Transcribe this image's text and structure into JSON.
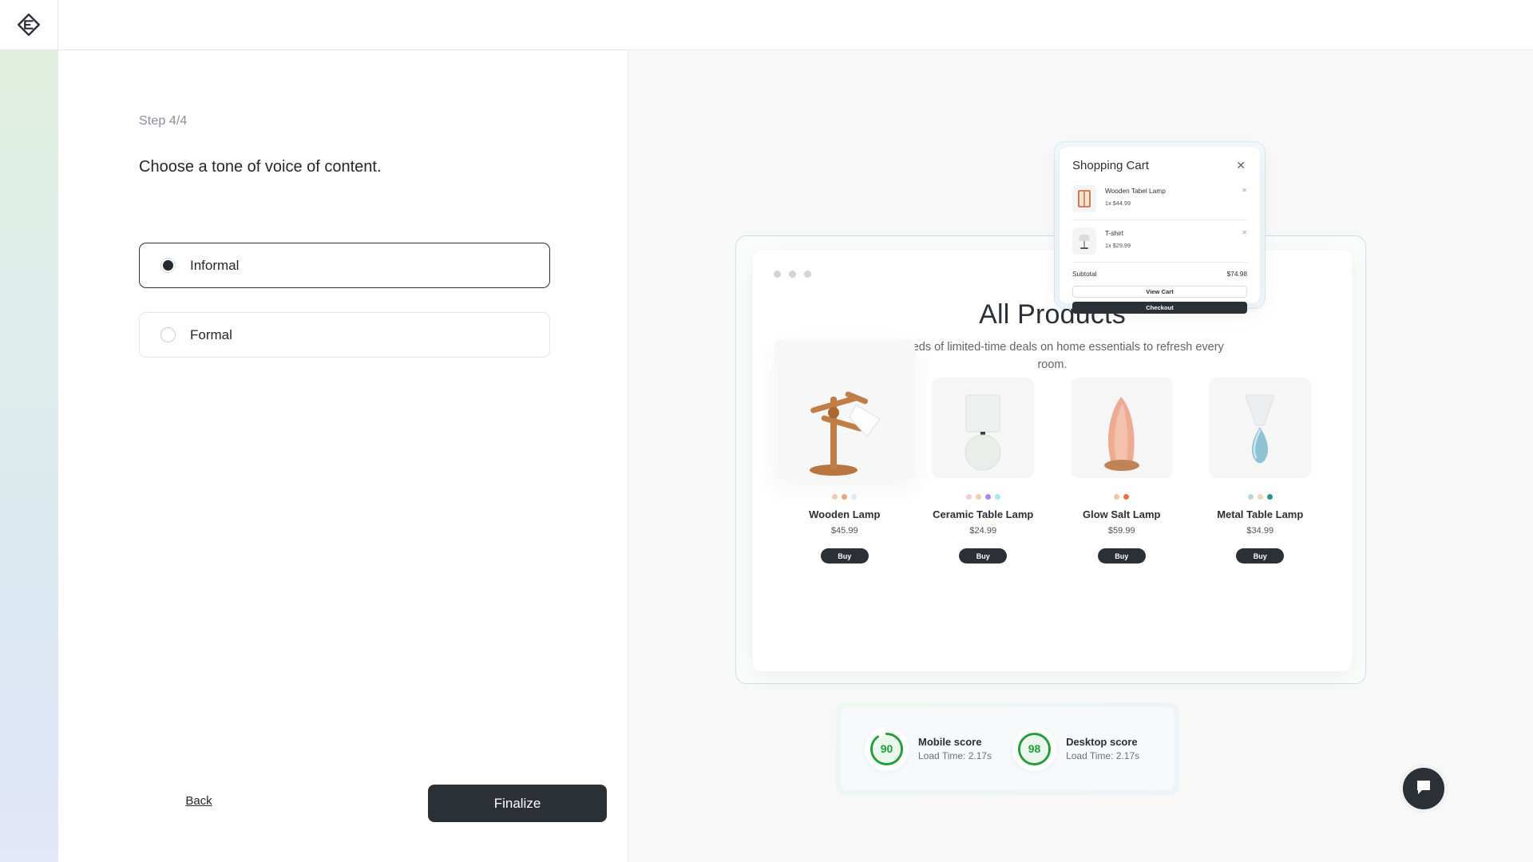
{
  "brand": {
    "logo_icon": "diamond-emblem-logo",
    "accent": "#2b2f36"
  },
  "wizard": {
    "step_label": "Step 4/4",
    "question": "Choose a tone of voice of content.",
    "options": [
      {
        "label": "Informal",
        "selected": true
      },
      {
        "label": "Formal",
        "selected": false
      }
    ],
    "back_label": "Back",
    "finalize_label": "Finalize"
  },
  "preview": {
    "site": {
      "title": "All Products",
      "subtitle": "Hundreds of limited-time deals on home essentials to refresh every room.",
      "buy_label": "Buy",
      "products": [
        {
          "name": "Wooden Lamp",
          "price": "$45.99",
          "swatches": [
            "#f3cfae",
            "#e8a882",
            "#e4ecec"
          ]
        },
        {
          "name": "Ceramic Table Lamp",
          "price": "$24.99",
          "swatches": [
            "#f6c9dd",
            "#f6cdaa",
            "#a08cf0",
            "#a9e6f2"
          ]
        },
        {
          "name": "Glow Salt Lamp",
          "price": "$59.99",
          "swatches": [
            "#f2c79a",
            "#f26d44"
          ]
        },
        {
          "name": "Metal Table Lamp",
          "price": "$34.99",
          "swatches": [
            "#bcd7df",
            "#f0d8b4",
            "#2b8f94"
          ]
        }
      ]
    },
    "cart": {
      "title": "Shopping Cart",
      "close_icon": "close-icon",
      "items": [
        {
          "name": "Wooden Tabel Lamp",
          "qty_price": "1x $44.99",
          "thumb_icon": "wooden-lamp-thumb"
        },
        {
          "name": "T-shirt",
          "qty_price": "1x $29.99",
          "thumb_icon": "table-lamp-thumb"
        }
      ],
      "subtotal_label": "Subtotal",
      "subtotal_value": "$74.98",
      "view_cart_label": "View Cart",
      "checkout_label": "Checkout"
    },
    "scores": {
      "ring_color": "#21a038",
      "items": [
        {
          "value": "90",
          "percent": 90,
          "title": "Mobile score",
          "subtitle": "Load Time: 2.17s"
        },
        {
          "value": "98",
          "percent": 98,
          "title": "Desktop score",
          "subtitle": "Load Time: 2.17s"
        }
      ]
    }
  },
  "chat": {
    "icon": "chat-bubble-icon"
  }
}
